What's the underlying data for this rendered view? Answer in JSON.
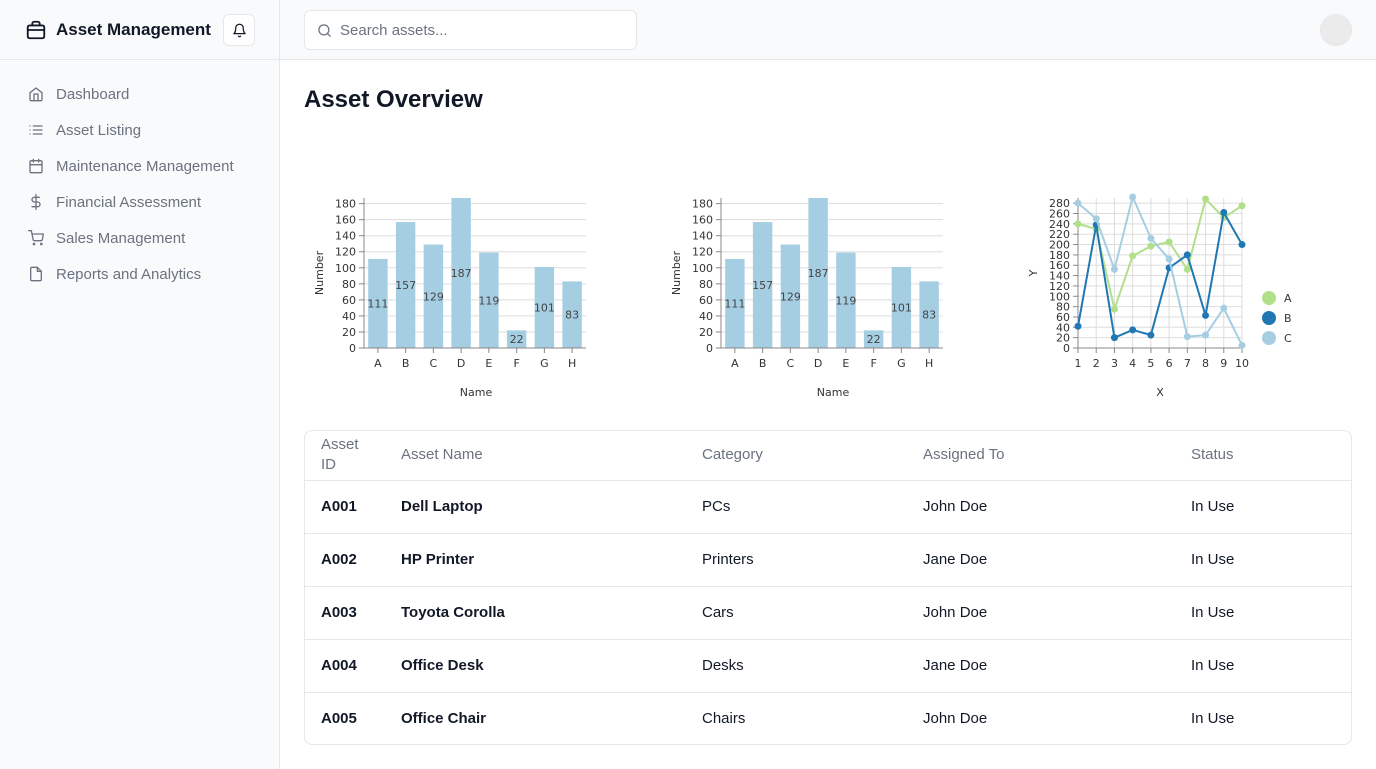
{
  "app": {
    "title": "Asset Management"
  },
  "icons": {
    "brand": "package-icon",
    "bell": "bell-icon",
    "search": "search-icon"
  },
  "sidebar": {
    "items": [
      {
        "label": "Dashboard",
        "icon": "home-icon"
      },
      {
        "label": "Asset Listing",
        "icon": "list-icon"
      },
      {
        "label": "Maintenance Management",
        "icon": "calendar-icon"
      },
      {
        "label": "Financial Assessment",
        "icon": "dollar-icon"
      },
      {
        "label": "Sales Management",
        "icon": "cart-icon"
      },
      {
        "label": "Reports and Analytics",
        "icon": "file-icon"
      }
    ]
  },
  "search": {
    "placeholder": "Search assets..."
  },
  "main": {
    "title": "Asset Overview"
  },
  "chart_data": [
    {
      "type": "bar",
      "categories": [
        "A",
        "B",
        "C",
        "D",
        "E",
        "F",
        "G",
        "H"
      ],
      "values": [
        111,
        157,
        129,
        187,
        119,
        22,
        101,
        83
      ],
      "title": "",
      "xlabel": "Name",
      "ylabel": "Number",
      "ylim": [
        0,
        187
      ],
      "yticks": [
        0,
        20,
        40,
        60,
        80,
        100,
        120,
        140,
        160,
        180
      ],
      "color": "#a6cee3",
      "data_labels": true,
      "grid": true
    },
    {
      "type": "bar",
      "categories": [
        "A",
        "B",
        "C",
        "D",
        "E",
        "F",
        "G",
        "H"
      ],
      "values": [
        111,
        157,
        129,
        187,
        119,
        22,
        101,
        83
      ],
      "title": "",
      "xlabel": "Name",
      "ylabel": "Number",
      "ylim": [
        0,
        187
      ],
      "yticks": [
        0,
        20,
        40,
        60,
        80,
        100,
        120,
        140,
        160,
        180
      ],
      "color": "#a6cee3",
      "data_labels": true,
      "grid": true
    },
    {
      "type": "line",
      "x": [
        1,
        2,
        3,
        4,
        5,
        6,
        7,
        8,
        9,
        10
      ],
      "series": [
        {
          "name": "A",
          "color": "#b2df8a",
          "values": [
            240,
            230,
            75,
            178,
            197,
            205,
            152,
            288,
            252,
            275
          ]
        },
        {
          "name": "B",
          "color": "#1f78b4",
          "values": [
            42,
            238,
            20,
            35,
            25,
            155,
            180,
            63,
            262,
            200
          ]
        },
        {
          "name": "C",
          "color": "#a6cee3",
          "values": [
            280,
            250,
            152,
            292,
            212,
            172,
            22,
            25,
            77,
            5
          ]
        }
      ],
      "title": "",
      "xlabel": "X",
      "ylabel": "Y",
      "xlim": [
        1,
        10
      ],
      "ylim": [
        0,
        290
      ],
      "yticks": [
        0,
        20,
        40,
        60,
        80,
        100,
        120,
        140,
        160,
        180,
        200,
        220,
        240,
        260,
        280
      ],
      "legend": "right",
      "grid": true
    }
  ],
  "table": {
    "headers": [
      "Asset ID",
      "Asset Name",
      "Category",
      "Assigned To",
      "Status"
    ],
    "rows": [
      [
        "A001",
        "Dell Laptop",
        "PCs",
        "John Doe",
        "In Use"
      ],
      [
        "A002",
        "HP Printer",
        "Printers",
        "Jane Doe",
        "In Use"
      ],
      [
        "A003",
        "Toyota Corolla",
        "Cars",
        "John Doe",
        "In Use"
      ],
      [
        "A004",
        "Office Desk",
        "Desks",
        "Jane Doe",
        "In Use"
      ],
      [
        "A005",
        "Office Chair",
        "Chairs",
        "John Doe",
        "In Use"
      ]
    ]
  }
}
